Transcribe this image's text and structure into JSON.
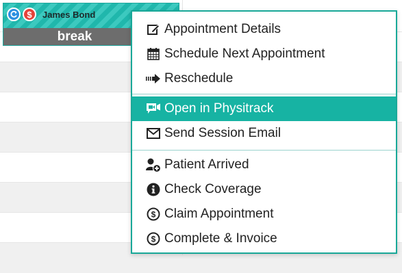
{
  "appointment": {
    "patient_name": "James Bond",
    "status_label": "break",
    "icons": [
      "refresh-icon",
      "dollar-icon"
    ]
  },
  "context_menu": {
    "items": [
      {
        "label": "Appointment Details",
        "icon": "edit-icon"
      },
      {
        "label": "Schedule Next Appointment",
        "icon": "calendar-icon"
      },
      {
        "label": "Reschedule",
        "icon": "arrow-right-icon"
      },
      {
        "label": "Open in Physitrack",
        "icon": "video-chat-icon",
        "highlighted": true
      },
      {
        "label": "Send Session Email",
        "icon": "envelope-icon"
      },
      {
        "label": "Patient Arrived",
        "icon": "user-add-icon"
      },
      {
        "label": "Check Coverage",
        "icon": "info-icon"
      },
      {
        "label": "Claim Appointment",
        "icon": "dollar-circle-icon"
      },
      {
        "label": "Complete & Invoice",
        "icon": "dollar-circle-icon"
      }
    ]
  },
  "colors": {
    "accent": "#17b3a3",
    "menu_border": "#18a898",
    "appointment_bar": "#6d6d6d",
    "stripe_light": "#3cc9bf",
    "stripe_dark": "#20b7ac"
  }
}
